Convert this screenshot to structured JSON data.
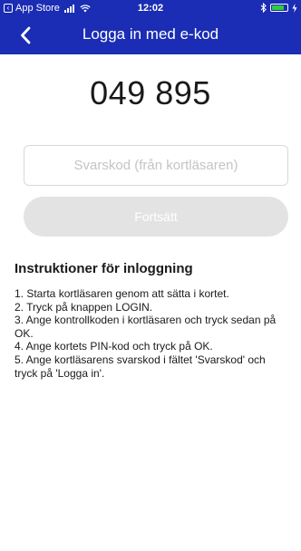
{
  "status_bar": {
    "back_app_label": "App Store",
    "time": "12:02",
    "battery_level": 0.8,
    "battery_color": "#2ecc40"
  },
  "nav": {
    "title": "Logga in med e-kod",
    "back_icon": "chevron-left-icon"
  },
  "challenge_code": "049 895",
  "response_field": {
    "placeholder": "Svarskod (från kortläsaren)",
    "value": ""
  },
  "continue_button": {
    "label": "Fortsätt",
    "enabled": false
  },
  "instructions": {
    "title": "Instruktioner för inloggning",
    "steps": [
      "1. Starta kortläsaren genom att sätta i kortet.",
      "2. Tryck på knappen LOGIN.",
      "3. Ange kontrollkoden i kortläsaren och tryck sedan på OK.",
      "4. Ange kortets PIN-kod och tryck på OK.",
      "5. Ange kortläsarens svarskod i fältet 'Svarskod' och tryck på 'Logga in'."
    ]
  },
  "colors": {
    "header_background": "#1a2db4",
    "disabled_button": "#e3e3e3"
  }
}
